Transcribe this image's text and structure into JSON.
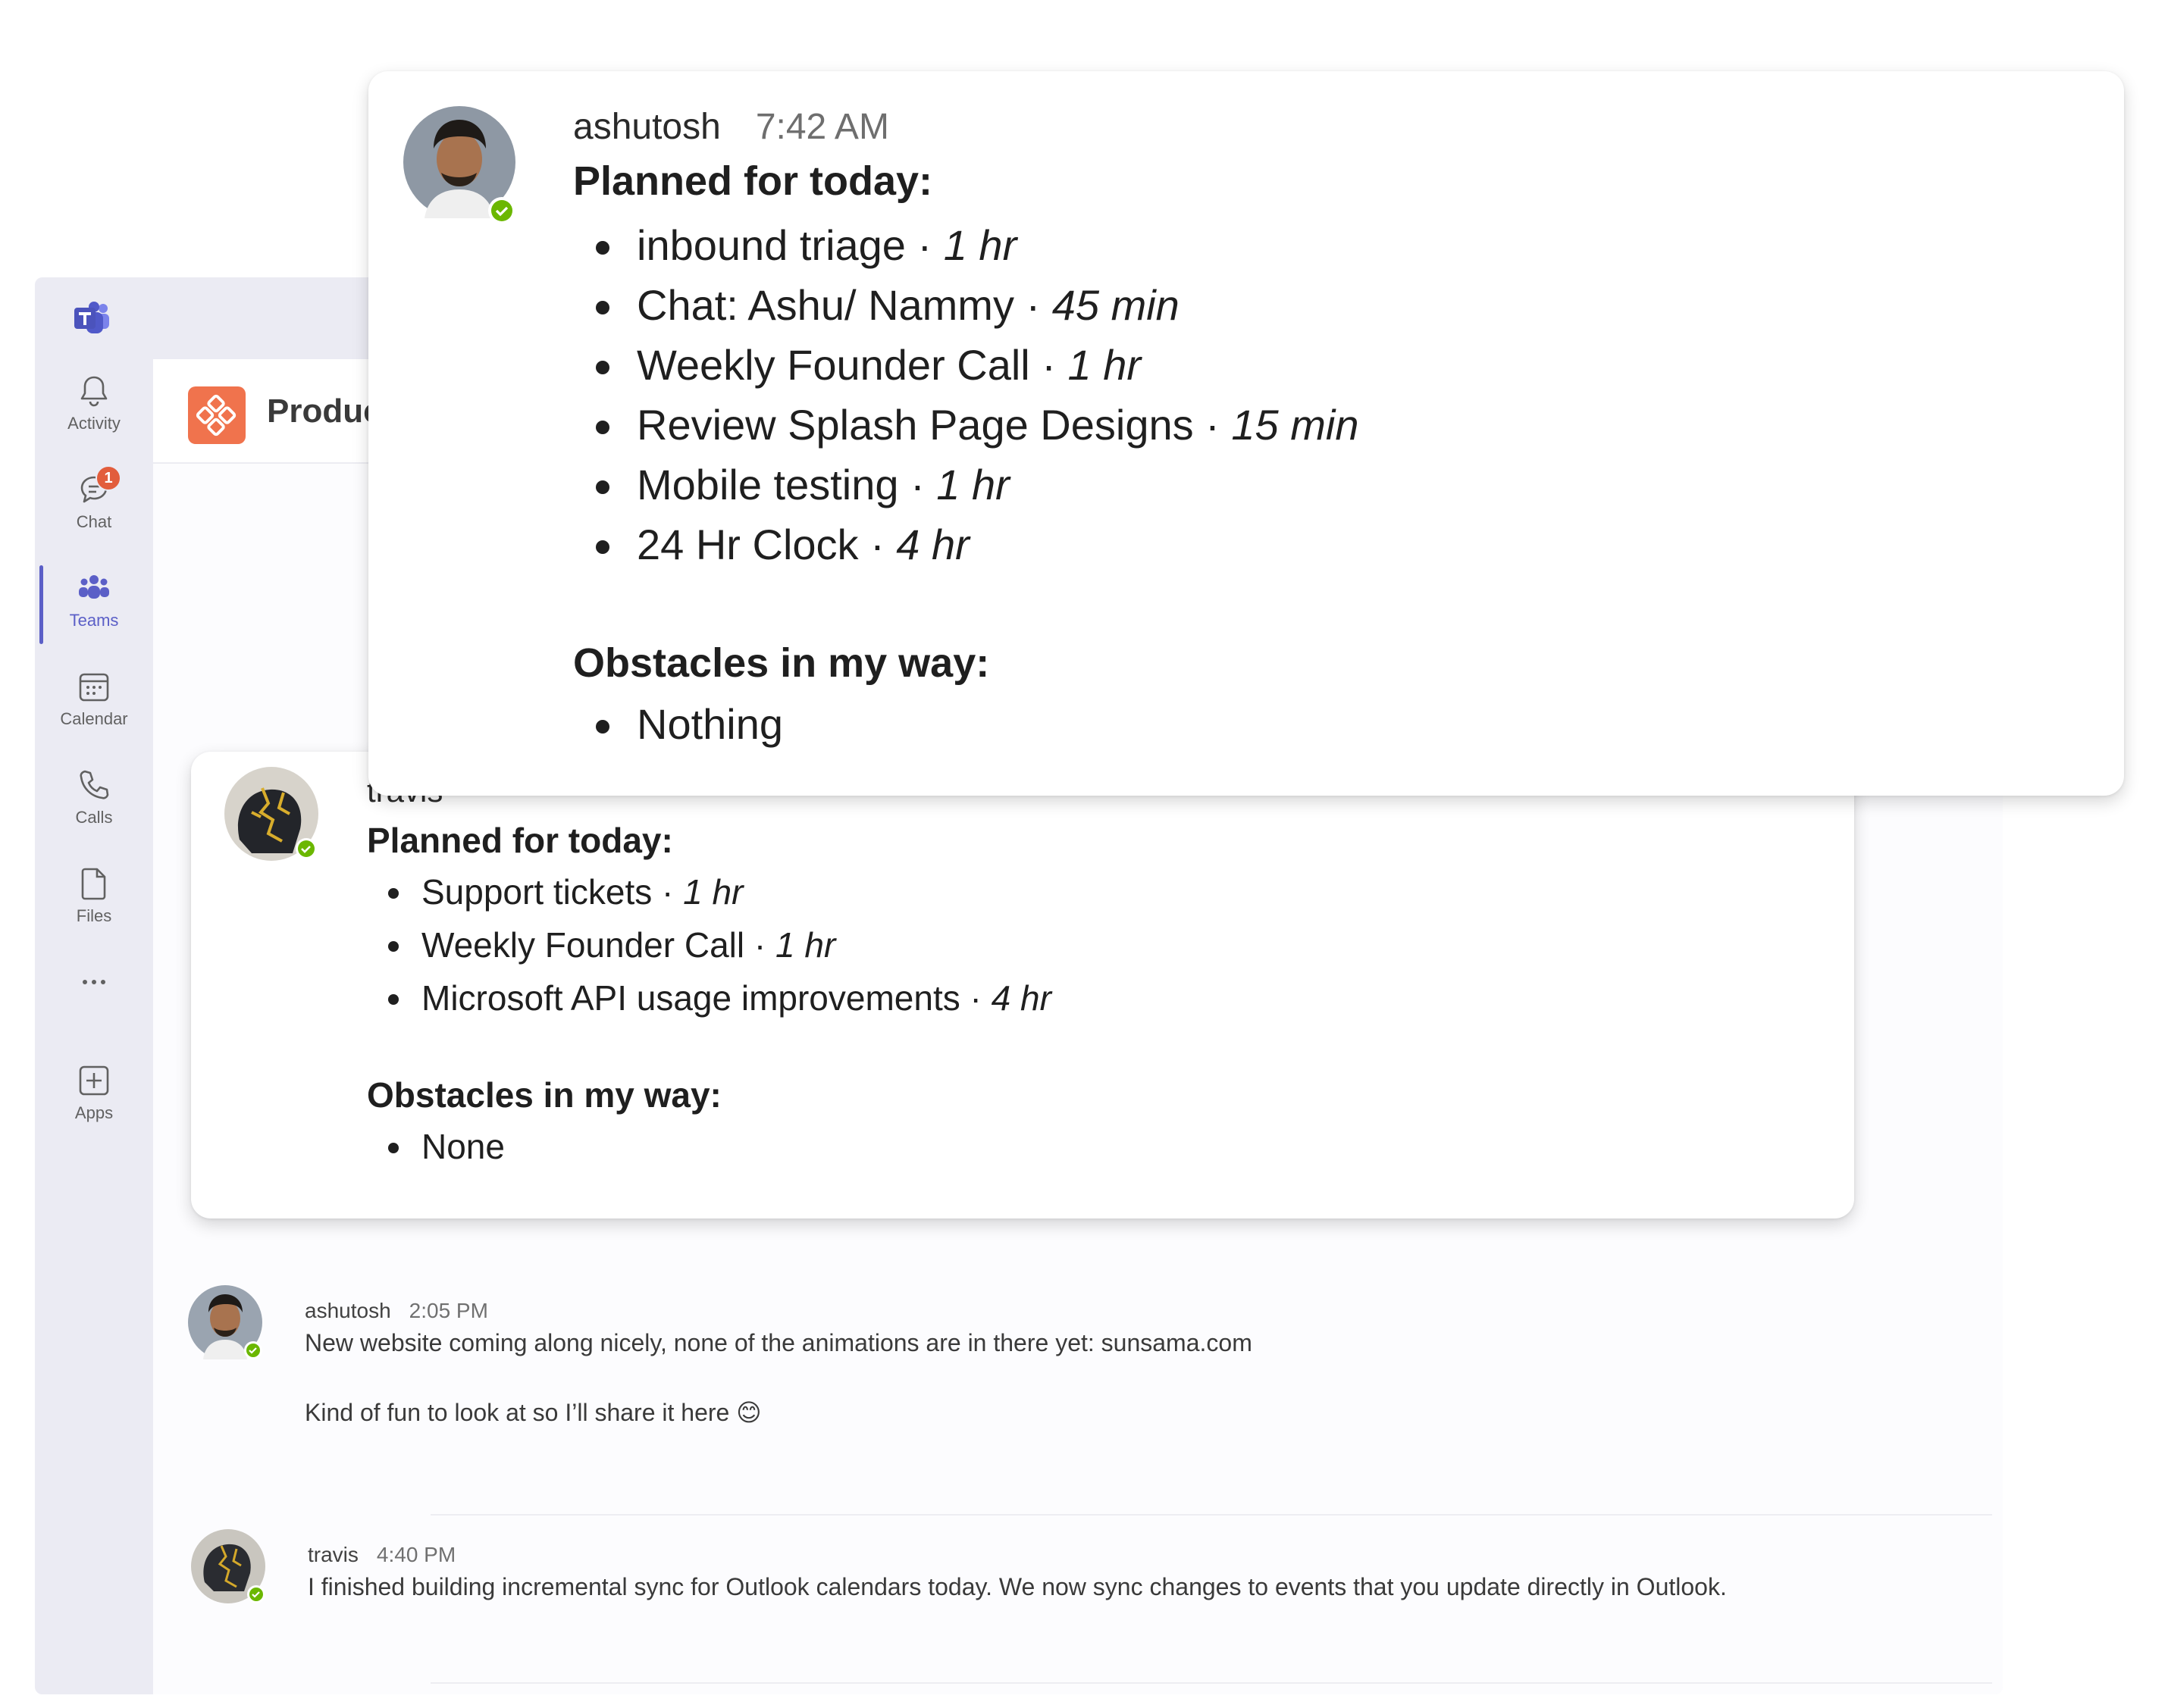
{
  "app": {
    "channel_name": "Produc",
    "accent_color": "#5b5fc7",
    "app_logo_color": "#f0734d"
  },
  "rail": {
    "items": [
      {
        "label": "Activity",
        "icon": "bell-icon"
      },
      {
        "label": "Chat",
        "icon": "chat-icon",
        "badge": "1"
      },
      {
        "label": "Teams",
        "icon": "teams-icon",
        "active": true
      },
      {
        "label": "Calendar",
        "icon": "calendar-icon"
      },
      {
        "label": "Calls",
        "icon": "phone-icon"
      },
      {
        "label": "Files",
        "icon": "file-icon"
      },
      {
        "label": "",
        "icon": "more-icon"
      },
      {
        "label": "Apps",
        "icon": "add-app-icon"
      }
    ]
  },
  "card_ashutosh": {
    "author": "ashutosh",
    "time": "7:42 AM",
    "planned_heading": "Planned for today:",
    "planned": [
      {
        "task": "inbound triage",
        "duration": "1 hr"
      },
      {
        "task": "Chat: Ashu/ Nammy",
        "duration": "45 min"
      },
      {
        "task": "Weekly Founder Call",
        "duration": "1 hr"
      },
      {
        "task": "Review Splash Page Designs",
        "duration": "15 min"
      },
      {
        "task": "Mobile testing",
        "duration": "1 hr"
      },
      {
        "task": "24 Hr Clock",
        "duration": "4 hr"
      }
    ],
    "obstacles_heading": "Obstacles in my way:",
    "obstacles": [
      "Nothing"
    ]
  },
  "card_travis": {
    "author": "travis",
    "planned_heading": "Planned for today:",
    "planned": [
      {
        "task": "Support tickets",
        "duration": "1 hr"
      },
      {
        "task": "Weekly Founder Call",
        "duration": "1 hr"
      },
      {
        "task": "Microsoft API usage improvements",
        "duration": "4 hr"
      }
    ],
    "obstacles_heading": "Obstacles in my way:",
    "obstacles": [
      "None"
    ]
  },
  "messages": [
    {
      "author": "ashutosh",
      "time": "2:05 PM",
      "line1": "New website coming along nicely, none of the animations are in there yet: sunsama.com",
      "line2": "Kind of fun to look at so I’ll share it here 😊"
    },
    {
      "author": "travis",
      "time": "4:40 PM",
      "line1": "I finished building incremental sync for Outlook calendars today. We now sync changes to events that you update directly in Outlook."
    }
  ]
}
